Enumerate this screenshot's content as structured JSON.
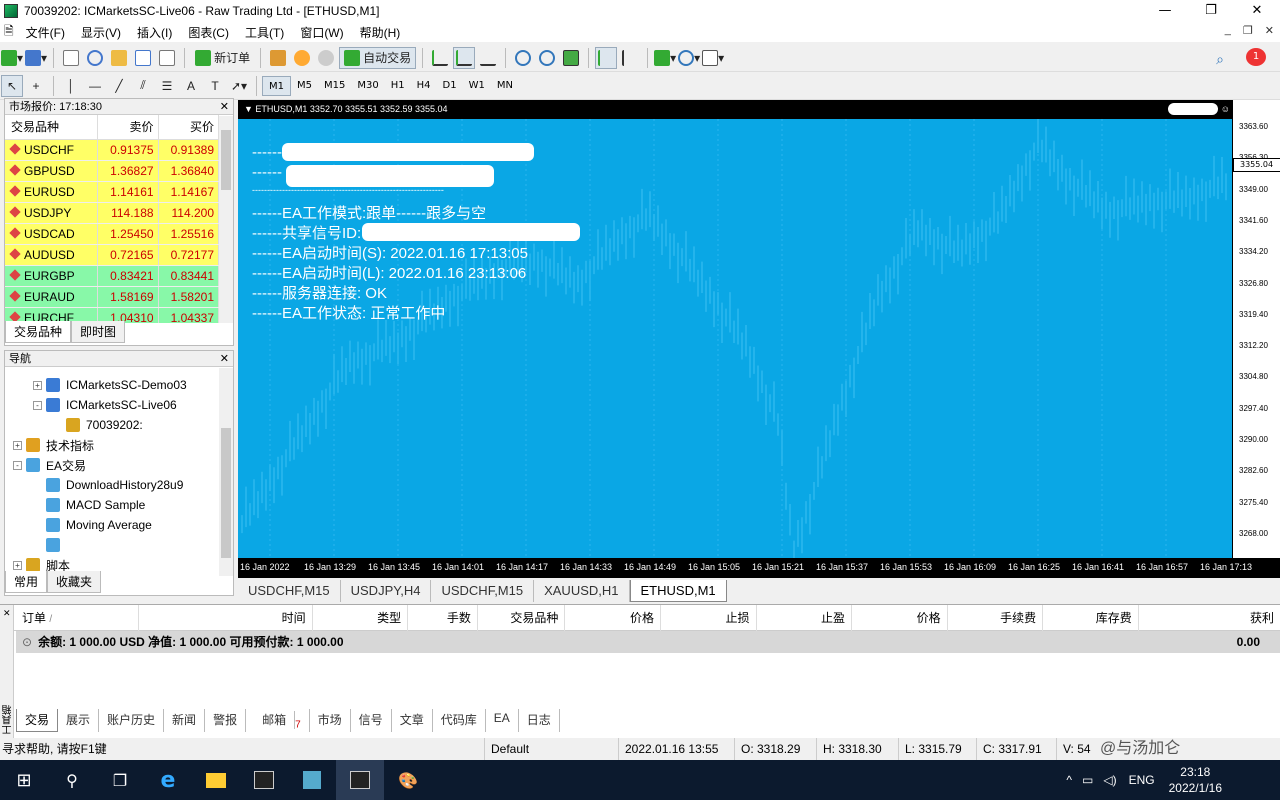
{
  "window": {
    "title": "70039202: ICMarketsSC-Live06 - Raw Trading Ltd - [ETHUSD,M1]"
  },
  "menu": [
    "文件(F)",
    "显示(V)",
    "插入(I)",
    "图表(C)",
    "工具(T)",
    "窗口(W)",
    "帮助(H)"
  ],
  "toolbar": {
    "new_order": "新订单",
    "auto_trade": "自动交易",
    "notify_count": "1"
  },
  "timeframes": [
    "M1",
    "M5",
    "M15",
    "M30",
    "H1",
    "H4",
    "D1",
    "W1",
    "MN"
  ],
  "active_timeframe": "M1",
  "market_watch": {
    "header": "市场报价: 17:18:30",
    "columns": [
      "交易品种",
      "卖价",
      "买价"
    ],
    "rows": [
      {
        "symbol": "USDCHF",
        "bid": "0.91375",
        "ask": "0.91389",
        "color": "yellow"
      },
      {
        "symbol": "GBPUSD",
        "bid": "1.36827",
        "ask": "1.36840",
        "color": "yellow"
      },
      {
        "symbol": "EURUSD",
        "bid": "1.14161",
        "ask": "1.14167",
        "color": "yellow"
      },
      {
        "symbol": "USDJPY",
        "bid": "114.188",
        "ask": "114.200",
        "color": "yellow"
      },
      {
        "symbol": "USDCAD",
        "bid": "1.25450",
        "ask": "1.25516",
        "color": "yellow"
      },
      {
        "symbol": "AUDUSD",
        "bid": "0.72165",
        "ask": "0.72177",
        "color": "yellow"
      },
      {
        "symbol": "EURGBP",
        "bid": "0.83421",
        "ask": "0.83441",
        "color": "green"
      },
      {
        "symbol": "EURAUD",
        "bid": "1.58169",
        "ask": "1.58201",
        "color": "green"
      },
      {
        "symbol": "EURCHF",
        "bid": "1.04310",
        "ask": "1.04337",
        "color": "green"
      }
    ],
    "tabs": [
      "交易品种",
      "即时图"
    ]
  },
  "navigator": {
    "header": "导航",
    "items": [
      {
        "label": "ICMarketsSC-Demo03",
        "indent": 1,
        "pm": "+",
        "icon": "server"
      },
      {
        "label": "ICMarketsSC-Live06",
        "indent": 1,
        "pm": "-",
        "icon": "server"
      },
      {
        "label": "70039202:",
        "indent": 2,
        "pm": "",
        "icon": "account"
      },
      {
        "label": "技术指标",
        "indent": 0,
        "pm": "+",
        "icon": "indicator"
      },
      {
        "label": "EA交易",
        "indent": 0,
        "pm": "-",
        "icon": "ea"
      },
      {
        "label": "DownloadHistory28u9",
        "indent": 1,
        "pm": "",
        "icon": "ea"
      },
      {
        "label": "MACD Sample",
        "indent": 1,
        "pm": "",
        "icon": "ea"
      },
      {
        "label": "Moving Average",
        "indent": 1,
        "pm": "",
        "icon": "ea"
      },
      {
        "label": "",
        "indent": 1,
        "pm": "",
        "icon": "ea"
      },
      {
        "label": "脚本",
        "indent": 0,
        "pm": "+",
        "icon": "script"
      }
    ],
    "tabs": [
      "常用",
      "收藏夹"
    ]
  },
  "chart": {
    "header": "ETHUSD,M1  3352.70 3355.51 3352.59 3355.04",
    "current_price": "3355.04",
    "y_labels": [
      "3363.60",
      "3356.30",
      "3349.00",
      "3341.60",
      "3334.20",
      "3326.80",
      "3319.40",
      "3312.20",
      "3304.80",
      "3297.40",
      "3290.00",
      "3282.60",
      "3275.40",
      "3268.00"
    ],
    "x_labels": [
      "16 Jan 2022",
      "16 Jan 13:29",
      "16 Jan 13:45",
      "16 Jan 14:01",
      "16 Jan 14:17",
      "16 Jan 14:33",
      "16 Jan 14:49",
      "16 Jan 15:05",
      "16 Jan 15:21",
      "16 Jan 15:37",
      "16 Jan 15:53",
      "16 Jan 16:09",
      "16 Jan 16:25",
      "16 Jan 16:41",
      "16 Jan 16:57",
      "16 Jan 17:13"
    ],
    "ea_lines": [
      "------EA工作模式:跟单------跟多与空",
      "------共享信号ID:",
      "------EA启动时间(S): 2022.01.16 17:13:05",
      "------EA启动时间(L): 2022.01.16 23:13:06",
      "------服务器连接: OK",
      "------EA工作状态: 正常工作中"
    ],
    "ea_dashes": [
      "------",
      "------",
      "----------------------------------------------------------------"
    ]
  },
  "chart_tabs": [
    "USDCHF,M15",
    "USDJPY,H4",
    "USDCHF,M15",
    "XAUUSD,H1",
    "ETHUSD,M1"
  ],
  "terminal": {
    "columns": [
      "订单",
      "时间",
      "类型",
      "手数",
      "交易品种",
      "价格",
      "止损",
      "止盈",
      "价格",
      "手续费",
      "库存费",
      "获利"
    ],
    "balance_text": "余额: 1 000.00 USD  净值: 1 000.00  可用预付款: 1 000.00",
    "profit": "0.00",
    "tabs": [
      "交易",
      "展示",
      "账户历史",
      "新闻",
      "警报",
      "邮箱",
      "市场",
      "信号",
      "文章",
      "代码库",
      "EA",
      "日志"
    ],
    "mail_badge": "7",
    "side_label": "工具箱"
  },
  "status": {
    "help": "寻求帮助, 请按F1键",
    "profile": "Default",
    "datetime": "2022.01.16 13:55",
    "open": "O: 3318.29",
    "high": "H: 3318.30",
    "low": "L: 3315.79",
    "close": "C: 3317.91",
    "volume": "V: 54"
  },
  "tray": {
    "lang": "ENG",
    "time": "23:18",
    "date": "2022/1/16",
    "watermark": "@与汤加仑"
  }
}
